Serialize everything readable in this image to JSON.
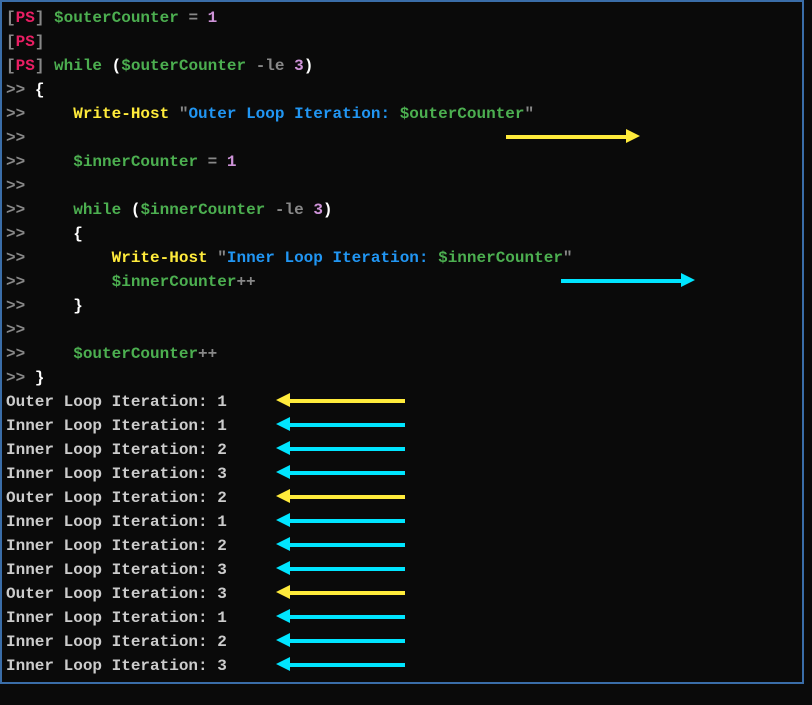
{
  "prompt": {
    "ps": "PS",
    "cont": ">>"
  },
  "code": {
    "line1_var": "$outerCounter",
    "line1_eq": "=",
    "line1_val": "1",
    "line3_kw": "while",
    "line3_paren_open": "(",
    "line3_var": "$outerCounter",
    "line3_op": "-le",
    "line3_val": "3",
    "line3_paren_close": ")",
    "line4_brace": "{",
    "line5_indent": "    ",
    "line5_cmd": "Write-Host",
    "line5_quote1": "\"",
    "line5_str": "Outer Loop Iteration: ",
    "line5_strvar": "$outerCounter",
    "line5_quote2": "\"",
    "line7_indent": "    ",
    "line7_var": "$innerCounter",
    "line7_eq": "=",
    "line7_val": "1",
    "line9_indent": "    ",
    "line9_kw": "while",
    "line9_paren_open": "(",
    "line9_var": "$innerCounter",
    "line9_op": "-le",
    "line9_val": "3",
    "line9_paren_close": ")",
    "line10_indent": "    ",
    "line10_brace": "{",
    "line11_indent": "        ",
    "line11_cmd": "Write-Host",
    "line11_quote1": "\"",
    "line11_str": "Inner Loop Iteration: ",
    "line11_strvar": "$innerCounter",
    "line11_quote2": "\"",
    "line12_indent": "        ",
    "line12_var": "$innerCounter",
    "line12_op": "++",
    "line13_indent": "    ",
    "line13_brace": "}",
    "line15_indent": "    ",
    "line15_var": "$outerCounter",
    "line15_op": "++",
    "line16_brace": "}"
  },
  "output": {
    "lines": [
      {
        "text": "Outer Loop Iteration: 1",
        "color": "yellow"
      },
      {
        "text": "Inner Loop Iteration: 1",
        "color": "cyan"
      },
      {
        "text": "Inner Loop Iteration: 2",
        "color": "cyan"
      },
      {
        "text": "Inner Loop Iteration: 3",
        "color": "cyan"
      },
      {
        "text": "Outer Loop Iteration: 2",
        "color": "yellow"
      },
      {
        "text": "Inner Loop Iteration: 1",
        "color": "cyan"
      },
      {
        "text": "Inner Loop Iteration: 2",
        "color": "cyan"
      },
      {
        "text": "Inner Loop Iteration: 3",
        "color": "cyan"
      },
      {
        "text": "Outer Loop Iteration: 3",
        "color": "yellow"
      },
      {
        "text": "Inner Loop Iteration: 1",
        "color": "cyan"
      },
      {
        "text": "Inner Loop Iteration: 2",
        "color": "cyan"
      },
      {
        "text": "Inner Loop Iteration: 3",
        "color": "cyan"
      }
    ]
  }
}
